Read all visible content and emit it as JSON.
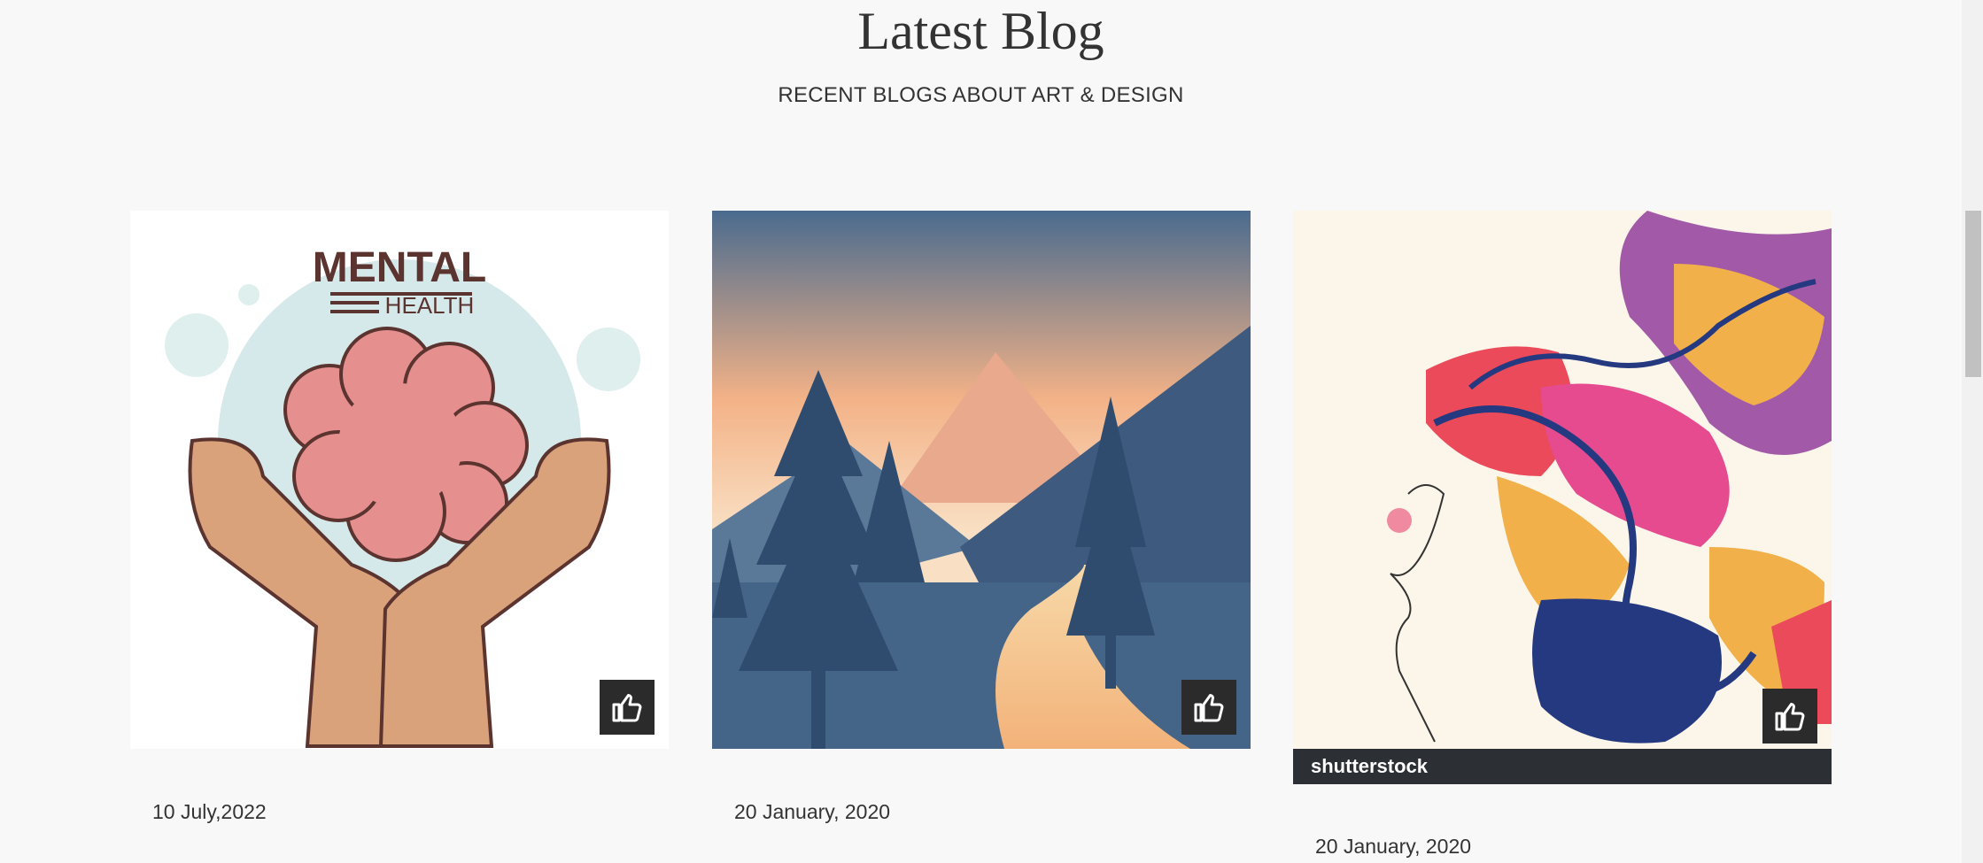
{
  "header": {
    "title": "Latest Blog",
    "subtitle": "RECENT BLOGS ABOUT ART & DESIGN"
  },
  "posts": [
    {
      "image_title": "MENTAL",
      "image_subtitle": "HEALTH",
      "date": "10 July,2022",
      "like_icon": "thumbs-up-icon"
    },
    {
      "date": "20 January, 2020",
      "like_icon": "thumbs-up-icon"
    },
    {
      "watermark": "shutterstock",
      "date": "20 January, 2020",
      "like_icon": "thumbs-up-icon"
    }
  ],
  "colors": {
    "background": "#f8f8f8",
    "like_button": "#2b2b2b",
    "text": "#333333"
  }
}
